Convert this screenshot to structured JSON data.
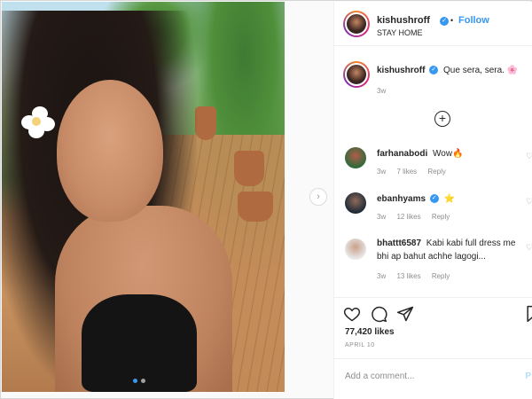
{
  "post": {
    "author": "kishushroff",
    "follow_label": "Follow",
    "separator": "•",
    "location": "STAY HOME",
    "caption_user": "kishushroff",
    "caption_text": "Que sera, sera. 🌸",
    "caption_age": "3w",
    "likes": "77,420 likes",
    "date": "APRIL 10",
    "add_comment_placeholder": "Add a comment...",
    "post_label": "P"
  },
  "comments": [
    {
      "user": "farhanabodi",
      "text": "Wow🔥",
      "age": "3w",
      "likes": "7 likes",
      "reply": "Reply",
      "verified": false
    },
    {
      "user": "ebanhyams",
      "text": "⭐",
      "age": "3w",
      "likes": "12 likes",
      "reply": "Reply",
      "verified": true
    },
    {
      "user": "bhattt6587",
      "text": "Kabi kabi full dress me bhi ap bahut achhe lagogi...",
      "age": "3w",
      "likes": "13 likes",
      "reply": "Reply",
      "verified": false
    }
  ],
  "icons": {
    "verified": "✓",
    "next": "›",
    "plus": "+",
    "heart": "♡"
  },
  "colors": {
    "accent": "#3897f0",
    "muted": "#8e8e8e",
    "text": "#262626"
  }
}
